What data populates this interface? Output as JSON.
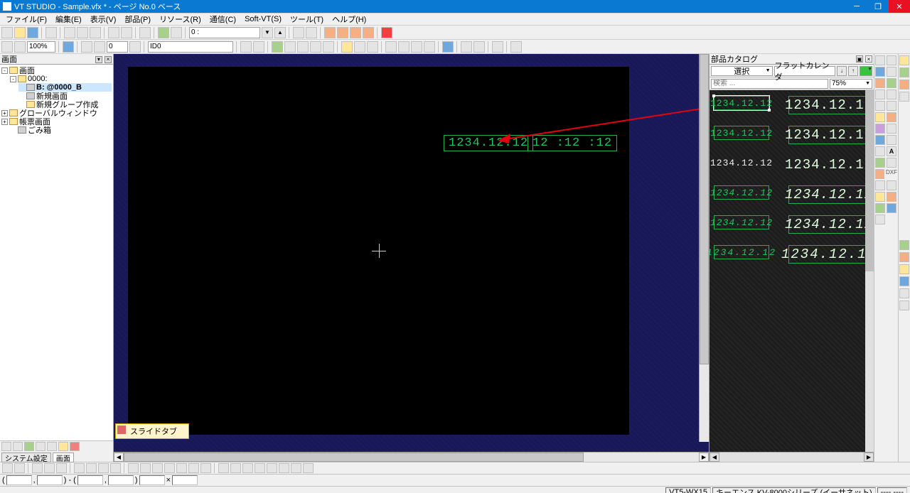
{
  "titlebar": {
    "title": "VT STUDIO - Sample.vfx * - ページ No.0 ベース"
  },
  "menu": [
    "ファイル(F)",
    "編集(E)",
    "表示(V)",
    "部品(P)",
    "リソース(R)",
    "通信(C)",
    "Soft-VT(S)",
    "ツール(T)",
    "ヘルプ(H)"
  ],
  "toolbar1": {
    "page_combo": "0 :"
  },
  "toolbar2": {
    "zoom": "100%",
    "spin": "0",
    "id": "ID0"
  },
  "tree": {
    "title": "画面",
    "nodes": {
      "root": "画面",
      "n0000": "0000:",
      "b0000": "B: @0000_B",
      "new_screen": "新規画面",
      "new_group": "新規グループ作成",
      "global_win": "グローバルウィンドウ",
      "book_screen": "帳票画面",
      "trash": "ごみ箱"
    },
    "tabs": {
      "settings": "システム設定",
      "screen": "画面"
    }
  },
  "canvas": {
    "item1": "1234.12.12",
    "item2": "12 :12 :12",
    "slide_tab": "スライドタブ"
  },
  "catalog": {
    "title": "部品カタログ",
    "select_label": "選択",
    "type_label": "フラットカレンダ",
    "search_placeholder": "検索 ...",
    "zoom": "75%",
    "items": {
      "small": "1234.12.12",
      "large": "1234.12.12"
    }
  },
  "right_strip_labels": {
    "dxf": "DXF"
  },
  "status": {
    "model": "VT5-WX15",
    "plc": "キーエンス KV-8000シリーズ (イーサネット)",
    "pos": "----,----"
  },
  "bottom_fields": {
    "f1": "(",
    "f2": ",",
    "f3": ") - (",
    "f4": ",",
    "f5": ")",
    "f6": "×"
  }
}
